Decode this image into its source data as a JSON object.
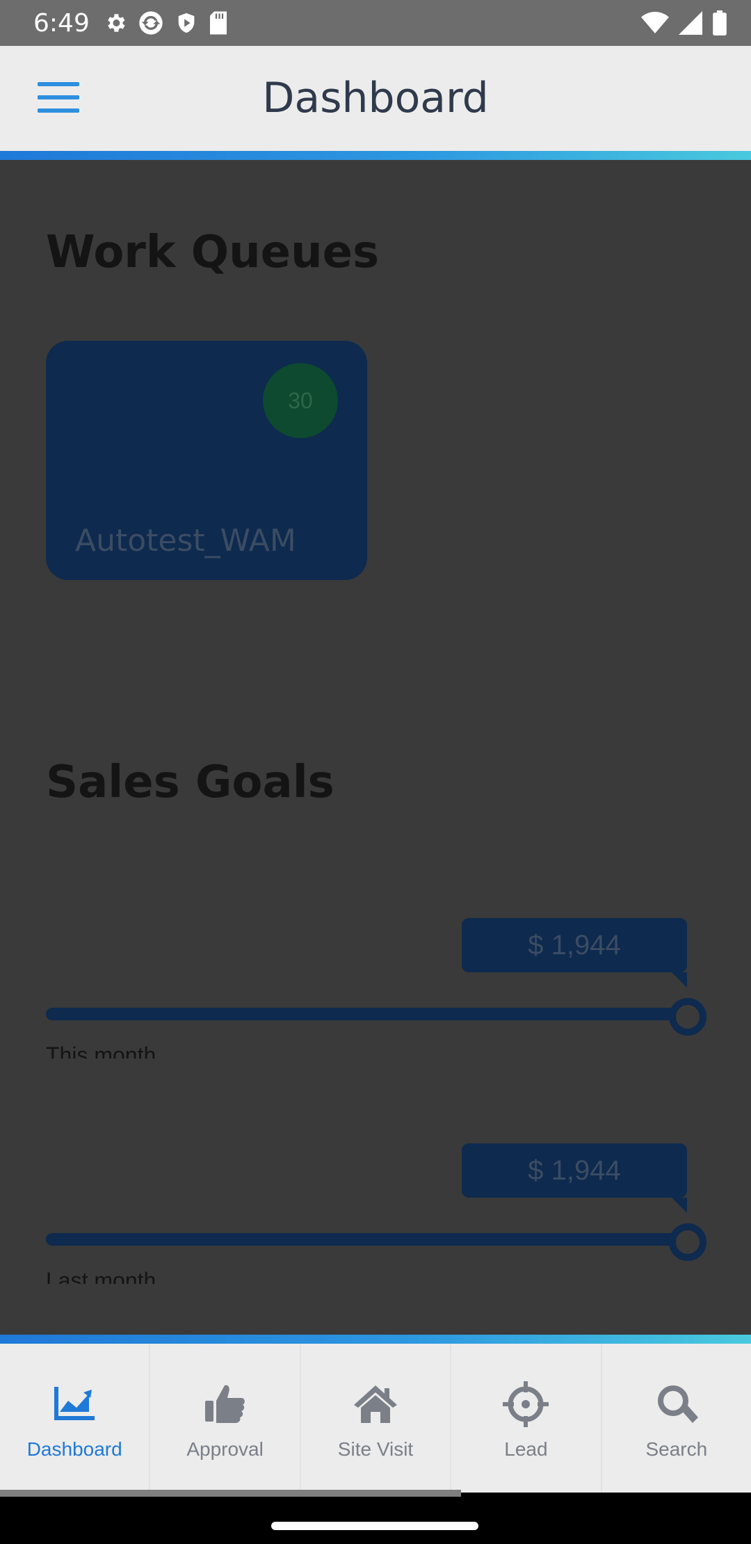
{
  "status_bar": {
    "time": "6:49",
    "left_icons": [
      "gear-icon",
      "sync-icon",
      "shield-icon",
      "sd-card-icon"
    ],
    "right_icons": [
      "wifi-icon",
      "signal-icon",
      "battery-icon"
    ]
  },
  "header": {
    "title": "Dashboard",
    "menu_icon": "hamburger-menu-icon"
  },
  "work_queues": {
    "title": "Work Queues",
    "cards": [
      {
        "name": "Autotest_WAM",
        "count": "30"
      }
    ]
  },
  "sales_goals": {
    "title": "Sales Goals",
    "goals": [
      {
        "amount": "$ 1,944",
        "label": "This month",
        "progress": 1.0
      },
      {
        "amount": "$ 1,944",
        "label": "Last month",
        "progress": 1.0
      }
    ]
  },
  "bottom_nav": {
    "items": [
      {
        "label": "Dashboard",
        "icon": "chart-trend-icon",
        "active": true
      },
      {
        "label": "Approval",
        "icon": "thumbs-up-icon",
        "active": false
      },
      {
        "label": "Site Visit",
        "icon": "home-icon",
        "active": false
      },
      {
        "label": "Lead",
        "icon": "crosshair-icon",
        "active": false
      },
      {
        "label": "Search",
        "icon": "search-icon",
        "active": false
      }
    ]
  },
  "colors": {
    "accent": "#1f79d7",
    "accent_end": "#49c9de",
    "overlay_bg": "#3a3a3a",
    "card_bg": "#0e2a4e",
    "badge_bg": "#0d4a30"
  }
}
